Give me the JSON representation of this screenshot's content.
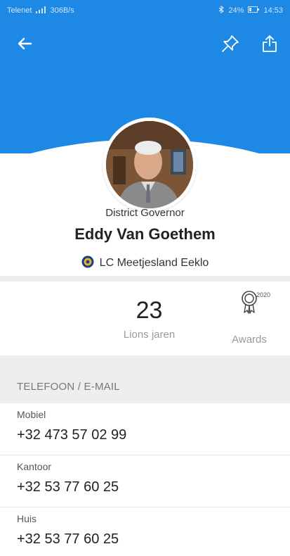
{
  "status_bar": {
    "carrier": "Telenet",
    "network_speed": "306B/s",
    "battery": "24%",
    "time": "14:53"
  },
  "app_bar": {
    "back_icon": "arrow-left-icon",
    "pin_icon": "pin-icon",
    "share_icon": "share-icon",
    "color": "#1e88e5"
  },
  "profile": {
    "role": "District Governor",
    "name": "Eddy Van Goethem",
    "club": "LC Meetjesland Eeklo"
  },
  "stats": {
    "lions_years_value": "23",
    "lions_years_label": "Lions jaren",
    "awards_year": "2020",
    "awards_label": "Awards"
  },
  "contact": {
    "section_title": "TELEFOON / E-MAIL",
    "items": [
      {
        "type": "Mobiel",
        "value": "+32 473 57 02 99"
      },
      {
        "type": "Kantoor",
        "value": "+32 53 77 60 25"
      },
      {
        "type": "Huis",
        "value": "+32 53 77 60 25"
      }
    ]
  }
}
